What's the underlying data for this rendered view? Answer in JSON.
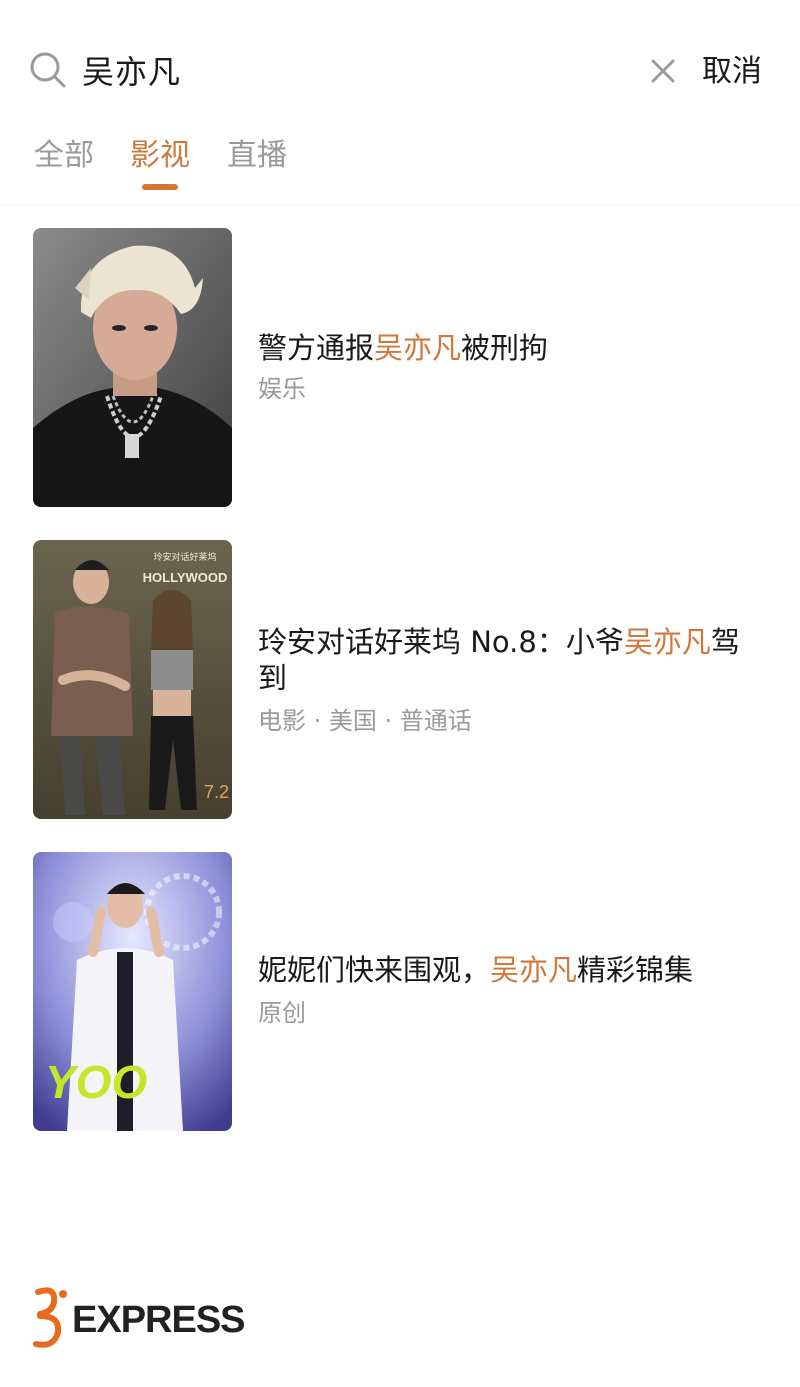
{
  "search": {
    "query": "吴亦凡",
    "cancel_label": "取消"
  },
  "tabs": [
    {
      "label": "全部",
      "active": false
    },
    {
      "label": "影视",
      "active": true
    },
    {
      "label": "直播",
      "active": false
    }
  ],
  "results": [
    {
      "title_before": "警方通报",
      "title_highlight": "吴亦凡",
      "title_after": "被刑拘",
      "meta": "娱乐"
    },
    {
      "title_before": "玲安对话好莱坞 No.8：小爷",
      "title_highlight": "吴亦凡",
      "title_after": "驾到",
      "meta": "电影 · 美国 · 普通话",
      "poster_brand": "HOLLYWOOD",
      "poster_date": "7.2"
    },
    {
      "title_before": "妮妮们快来围观，",
      "title_highlight": "吴亦凡",
      "title_after": "精彩锦集",
      "meta": "原创",
      "poster_brand": "YOO"
    }
  ],
  "watermark": {
    "text": "EXPRESS"
  },
  "colors": {
    "accent": "#d2763a",
    "text_primary": "#1a1a1a",
    "text_secondary": "#9a9a9a"
  }
}
